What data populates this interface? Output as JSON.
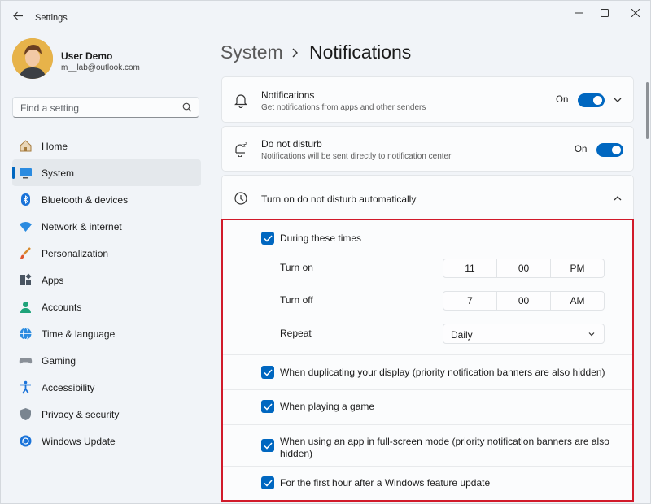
{
  "window": {
    "title": "Settings"
  },
  "profile": {
    "name": "User Demo",
    "email": "m__lab@outlook.com"
  },
  "search": {
    "placeholder": "Find a setting"
  },
  "nav": {
    "items": [
      {
        "label": "Home",
        "icon": "home-icon"
      },
      {
        "label": "System",
        "icon": "system-icon",
        "active": true
      },
      {
        "label": "Bluetooth & devices",
        "icon": "bluetooth-icon"
      },
      {
        "label": "Network & internet",
        "icon": "wifi-icon"
      },
      {
        "label": "Personalization",
        "icon": "brush-icon"
      },
      {
        "label": "Apps",
        "icon": "apps-icon"
      },
      {
        "label": "Accounts",
        "icon": "account-icon"
      },
      {
        "label": "Time & language",
        "icon": "globe-icon"
      },
      {
        "label": "Gaming",
        "icon": "gamepad-icon"
      },
      {
        "label": "Accessibility",
        "icon": "accessibility-icon"
      },
      {
        "label": "Privacy & security",
        "icon": "shield-icon"
      },
      {
        "label": "Windows Update",
        "icon": "update-icon"
      }
    ]
  },
  "header": {
    "parent": "System",
    "current": "Notifications"
  },
  "notifications": {
    "title": "Notifications",
    "subtitle": "Get notifications from apps and other senders",
    "state": "On"
  },
  "dnd": {
    "title": "Do not disturb",
    "subtitle": "Notifications will be sent directly to notification center",
    "state": "On"
  },
  "auto_dnd": {
    "title": "Turn on do not disturb automatically",
    "during_times": "During these times",
    "turn_on_label": "Turn on",
    "turn_on": {
      "hour": "11",
      "minute": "00",
      "period": "PM"
    },
    "turn_off_label": "Turn off",
    "turn_off": {
      "hour": "7",
      "minute": "00",
      "period": "AM"
    },
    "repeat_label": "Repeat",
    "repeat_value": "Daily",
    "options": [
      "When duplicating your display (priority notification banners are also hidden)",
      "When playing a game",
      "When using an app in full-screen mode (priority notification banners are also hidden)",
      "For the first hour after a Windows feature update"
    ]
  },
  "colors": {
    "accent": "#0067c0",
    "highlight_border": "#d11a2a"
  }
}
